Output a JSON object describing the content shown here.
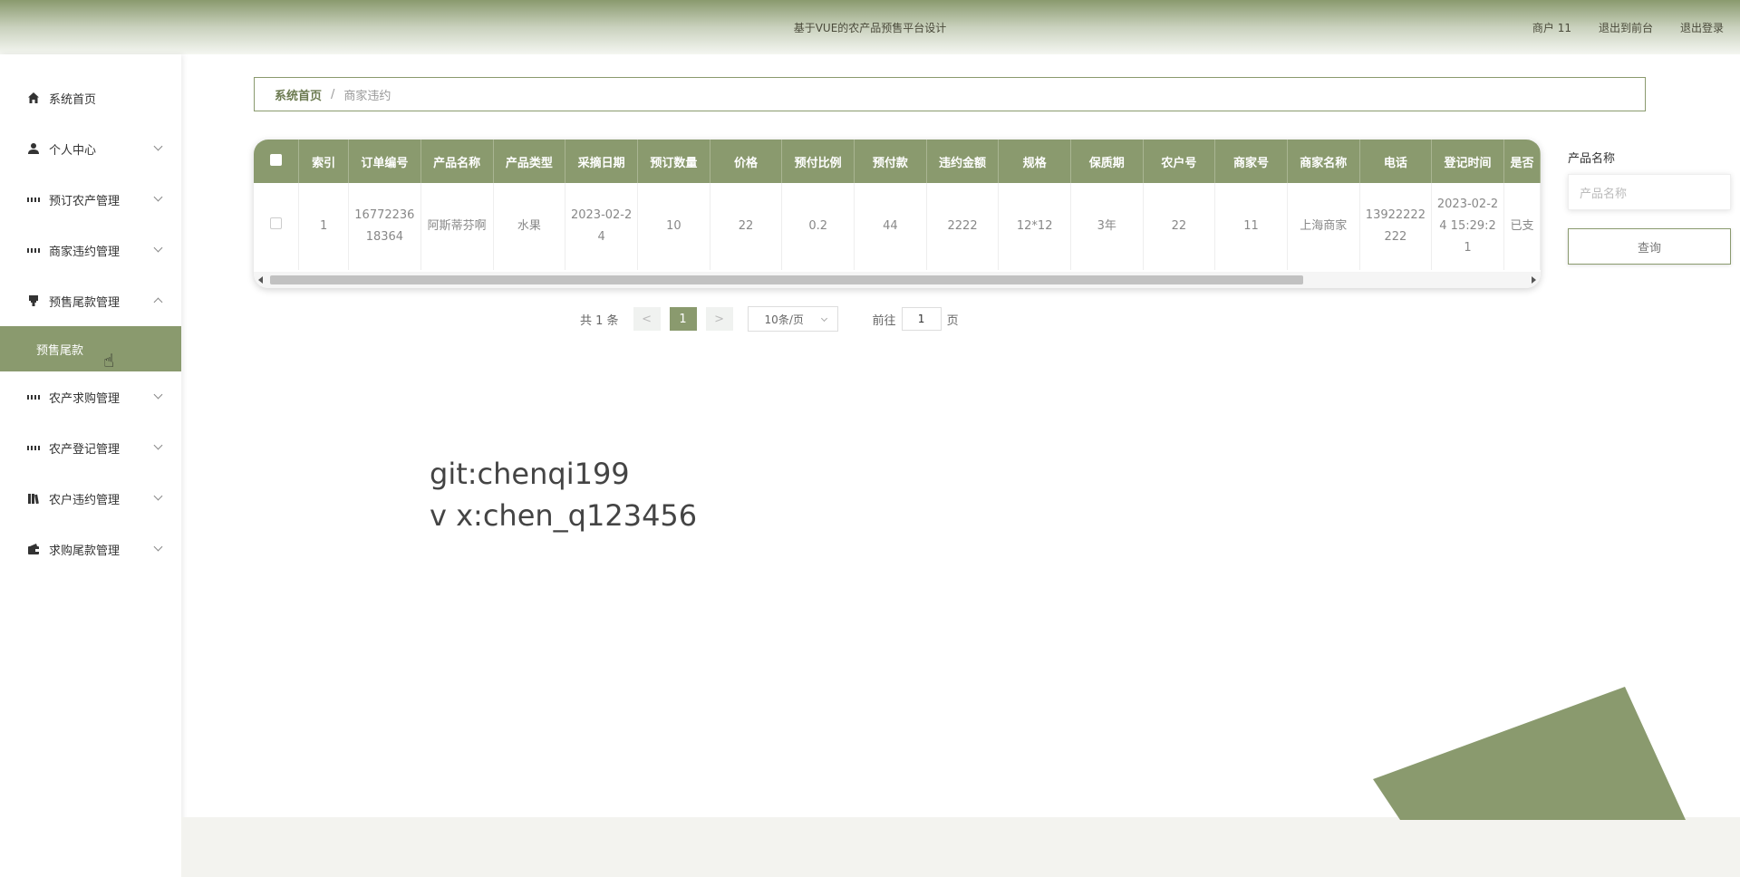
{
  "header": {
    "title": "基于VUE的农产品预售平台设计",
    "user": "商户 11",
    "back_front": "退出到前台",
    "logout": "退出登录"
  },
  "sidebar": {
    "items": [
      {
        "label": "系统首页",
        "icon": "home-icon"
      },
      {
        "label": "个人中心",
        "icon": "user-icon"
      },
      {
        "label": "预订农产管理",
        "icon": "grid-icon"
      },
      {
        "label": "商家违约管理",
        "icon": "grid-icon"
      },
      {
        "label": "预售尾款管理",
        "icon": "stamp-icon"
      },
      {
        "label": "农产求购管理",
        "icon": "grid-icon"
      },
      {
        "label": "农产登记管理",
        "icon": "grid-icon"
      },
      {
        "label": "农户违约管理",
        "icon": "books-icon"
      },
      {
        "label": "求购尾款管理",
        "icon": "wallet-icon"
      }
    ],
    "sub_item": "预售尾款"
  },
  "breadcrumb": {
    "home": "系统首页",
    "separator": "/",
    "current": "商家违约"
  },
  "table": {
    "headers": [
      "索引",
      "订单编号",
      "产品名称",
      "产品类型",
      "采摘日期",
      "预订数量",
      "价格",
      "预付比例",
      "预付款",
      "违约金额",
      "规格",
      "保质期",
      "农户号",
      "商家号",
      "商家名称",
      "电话",
      "登记时间",
      "是否"
    ],
    "rows": [
      [
        "1",
        "1677223618364",
        "阿斯蒂芬啊",
        "水果",
        "2023-02-24",
        "10",
        "22",
        "0.2",
        "44",
        "2222",
        "12*12",
        "3年",
        "22",
        "11",
        "上海商家",
        "13922222222",
        "2023-02-24 15:29:21",
        "已支"
      ]
    ]
  },
  "pagination": {
    "total": "共 1 条",
    "prev": "<",
    "page": "1",
    "next": ">",
    "page_size": "10条/页",
    "goto_label": "前往",
    "goto_value": "1",
    "page_suffix": "页"
  },
  "search": {
    "label": "产品名称",
    "placeholder": "产品名称",
    "button": "查询"
  },
  "watermark": {
    "line1": "git:chenqi199",
    "line2": "v x:chen_q123456"
  },
  "colors": {
    "accent": "#8a9a6e"
  }
}
